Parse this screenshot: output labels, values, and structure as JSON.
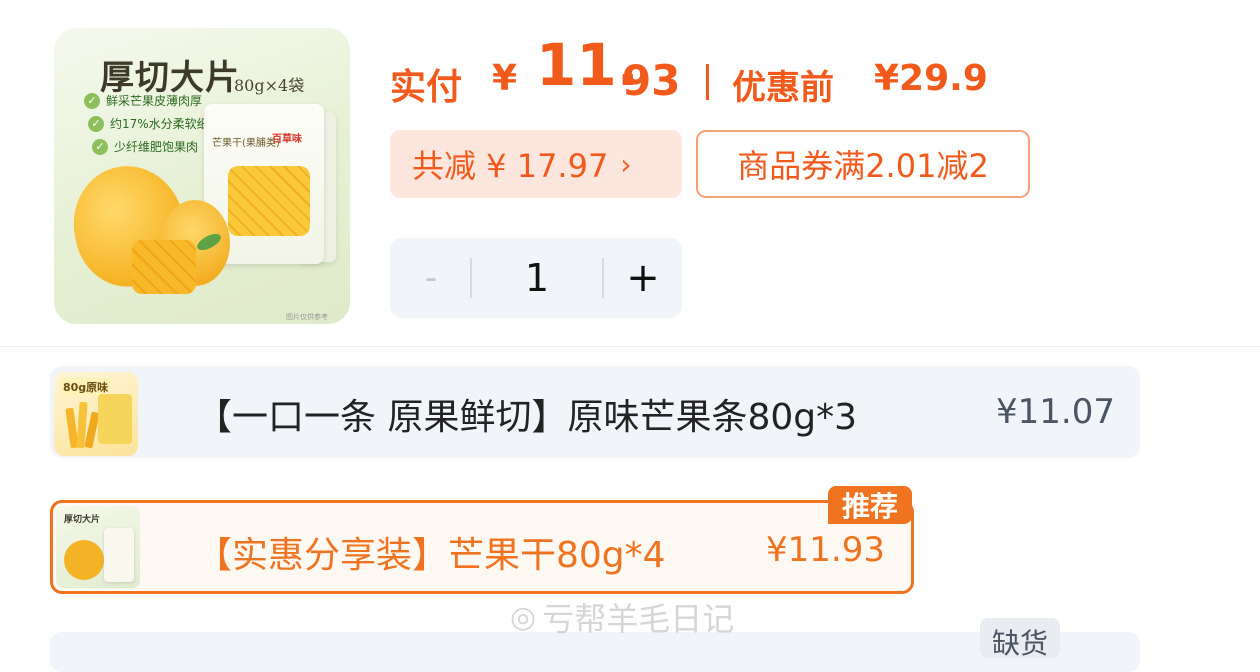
{
  "product_image": {
    "title": "厚切大片",
    "spec": "80g×4袋",
    "bullets": [
      "鲜采芒果皮薄肉厚",
      "约17%水分柔软细嫩",
      "少纤维肥饱果肉"
    ],
    "bag_label": "芒果干(果脯类)",
    "brand": "百草味",
    "footnote": "图片仅供参考"
  },
  "price": {
    "pay_label": "实付",
    "currency": "¥",
    "pay_integer": "11.",
    "pay_decimal": "93",
    "original_label": "优惠前",
    "original_price": "¥29.9"
  },
  "discount": {
    "total_save": "共减 ¥ 17.97",
    "arrow": "›",
    "coupon": "商品券满2.01减2"
  },
  "stepper": {
    "minus": "-",
    "value": "1",
    "plus": "+"
  },
  "variants": [
    {
      "thumb_label": "80g原味",
      "name": "【一口一条 原果鲜切】原味芒果条80g*3",
      "price": "¥11.07",
      "selected": false
    },
    {
      "thumb_label": "厚切大片",
      "name": "【实惠分享装】芒果干80g*4",
      "price": "¥11.93",
      "selected": true,
      "badge": "推荐"
    },
    {
      "badge": "缺货"
    }
  ],
  "watermark": "亏帮羊毛日记",
  "colors": {
    "accent": "#f25a1c",
    "selected_border": "#f0731f",
    "pill_bg": "#fde6de",
    "muted_bg": "#f1f4f9"
  }
}
